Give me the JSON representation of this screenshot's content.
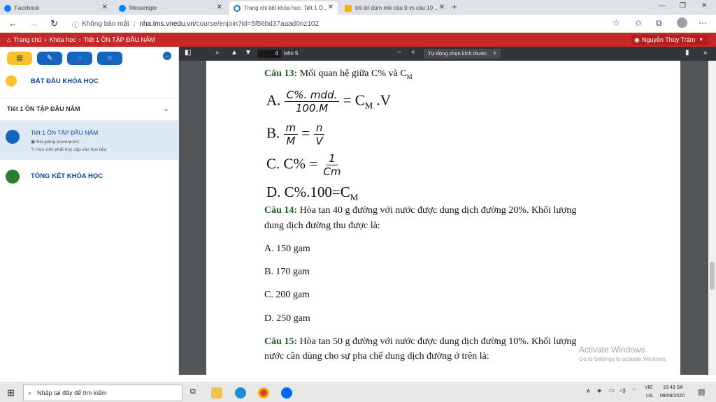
{
  "tabs": [
    {
      "title": "Facebook",
      "color": "#1877f2"
    },
    {
      "title": "Messenger",
      "color": "#0084ff"
    },
    {
      "title": "Trang chi tiết khóa học: Tiết 1 Ô...",
      "color": "#1a73e8"
    },
    {
      "title": "trả lời dùm mik câu 9 vs câu 10 ...",
      "color": "#f4b400"
    }
  ],
  "address": {
    "security": "Không bảo mật",
    "host": "nha.lms.vnedu.vn",
    "path": "/course/enjoin?id=5f56bd37aaad0nz102"
  },
  "site": {
    "crumbs": [
      "Trang chủ",
      "Khóa học",
      "Tiết 1 ÔN TẬP ĐẦU NĂM"
    ],
    "user": "Nguyễn Thùy Trâm"
  },
  "sidebar": {
    "start": "BẮT ĐẦU KHÓA HỌC",
    "section": "Tiết 1 ÔN TẬP ĐẦU NĂM",
    "lesson_title": "Tiết 1 ÔN TẬP ĐẦU NĂM",
    "lesson_sub1": "Bài giảng powerpoint",
    "lesson_sub2": "Học viên phải truy cập vào học liệu:",
    "end": "TỔNG KẾT KHÓA HỌC"
  },
  "pdf": {
    "page": "4",
    "of": "trên 5",
    "zoom": "Tự động chọn kích thước"
  },
  "content": {
    "q13_label": "Câu 13:",
    "q13_text": "Mối quan hệ giữa C% và C",
    "q13_sub": "M",
    "optA_letter": "A.",
    "optA_num": "C%. mdd.",
    "optA_den": "100.M",
    "optA_rhs": "= C",
    "optA_sub": "M",
    "optA_tail": " .V",
    "optB_letter": "B.",
    "optB_num1": "m",
    "optB_den1": "M",
    "optB_eq": "=",
    "optB_num2": "n",
    "optB_den2": "V",
    "optC_letter": "C.",
    "optC_lhs": "C% =",
    "optC_num": "1",
    "optC_den": "Cm",
    "optD_letter": "D.",
    "optD_text": "C%.100=C",
    "optD_sub": "M",
    "q14_label": "Câu 14:",
    "q14_line1": "Hòa tan 40 g đường với nước được dung dịch đường 20%. Khối lượng",
    "q14_line2": "dung dịch đường thu được là:",
    "q14_answers": [
      "A. 150 gam",
      "B. 170 gam",
      "C. 200 gam",
      "D. 250 gam"
    ],
    "q15_label": "Câu 15:",
    "q15_line1": "Hòa tan 50 g đường với nước được dung dịch đường 10%. Khối lượng",
    "q15_line2": "nước cần dùng cho sự pha chế dung dịch đường ở trên là:"
  },
  "watermark": {
    "title": "Activate Windows",
    "sub": "Go to Settings to activate Windows."
  },
  "taskbar": {
    "search": "Nhập tại đây để tìm kiếm",
    "lang": "VIE",
    "region": "US",
    "time": "10:43 SA",
    "date": "08/09/2020"
  },
  "colors": {
    "brand_red": "#c62828",
    "sidebar_blue": "#1565c0",
    "question_green": "#1b5e20"
  }
}
